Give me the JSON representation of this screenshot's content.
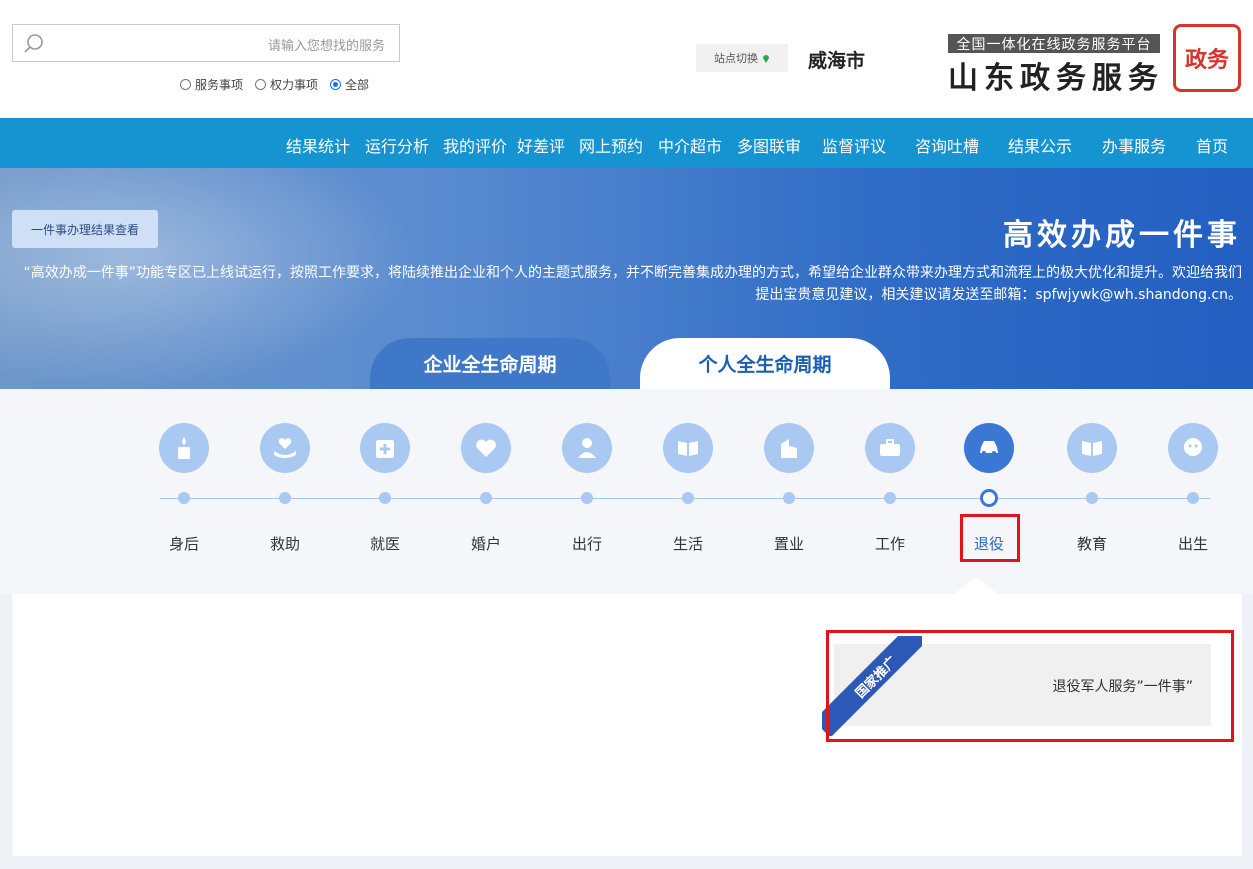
{
  "header": {
    "search": {
      "placeholder": "请输入您想找的服务"
    },
    "filter_options": [
      {
        "label": "全部",
        "selected": true
      },
      {
        "label": "权力事项",
        "selected": false
      },
      {
        "label": "服务事项",
        "selected": false
      }
    ],
    "site_switch_label": "站点切换",
    "city": "威海市",
    "logo_subtitle": "全国一体化在线政务服务平台",
    "logo_title": "山东政务服务",
    "seal_text": "政务"
  },
  "nav": {
    "items": [
      "首页",
      "办事服务",
      "结果公示",
      "咨询吐槽",
      "监督评议",
      "多图联审",
      "中介超市",
      "网上预约",
      "好差评",
      "我的评价",
      "运行分析",
      "结果统计"
    ]
  },
  "banner": {
    "title": "高效办成一件事",
    "result_button": "一件事办理结果查看",
    "description": "“高效办成一件事”功能专区已上线试运行，按照工作要求，将陆续推出企业和个人的主题式服务，并不断完善集成办理的方式，希望给企业群众带来办理方式和流程上的极大优化和提升。欢迎给我们提出宝贵意见建议，相关建议请发送至邮箱：spfwjywk@wh.shandong.cn。",
    "tabs": [
      {
        "label": "个人全生命周期",
        "active": true
      },
      {
        "label": "企业全生命周期",
        "active": false
      }
    ]
  },
  "lifecycle": {
    "stages": [
      {
        "label": "出生",
        "icon": "baby-icon",
        "active": false
      },
      {
        "label": "教育",
        "icon": "book-icon",
        "active": false
      },
      {
        "label": "退役",
        "icon": "car-icon",
        "active": true
      },
      {
        "label": "工作",
        "icon": "briefcase-icon",
        "active": false
      },
      {
        "label": "置业",
        "icon": "building-icon",
        "active": false
      },
      {
        "label": "生活",
        "icon": "book-open-icon",
        "active": false
      },
      {
        "label": "出行",
        "icon": "person-icon",
        "active": false
      },
      {
        "label": "婚户",
        "icon": "heart-icon",
        "active": false
      },
      {
        "label": "就医",
        "icon": "medical-icon",
        "active": false
      },
      {
        "label": "救助",
        "icon": "helping-hand-icon",
        "active": false
      },
      {
        "label": "身后",
        "icon": "candle-icon",
        "active": false
      }
    ]
  },
  "content": {
    "cards": [
      {
        "title": "退役军人服务”一件事”",
        "badge": "国家推广"
      }
    ]
  },
  "colors": {
    "nav_bg": "#1594d1",
    "active_blue": "#3b78d6",
    "highlight_red": "#e1141b"
  }
}
